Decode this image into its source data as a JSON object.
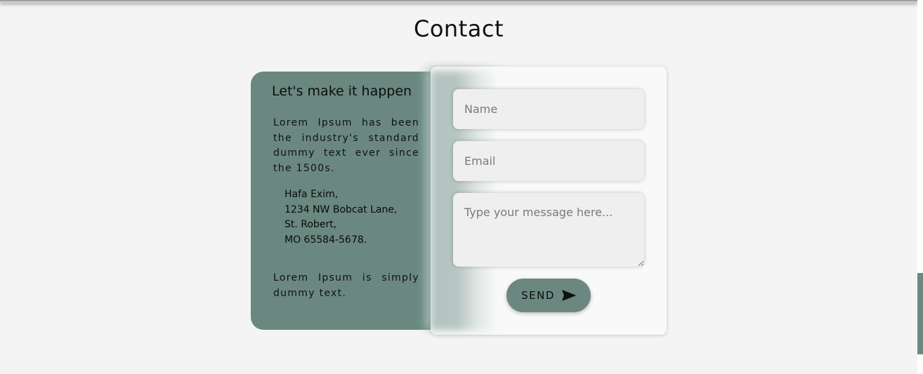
{
  "page": {
    "title": "Contact"
  },
  "info": {
    "heading": "Let's make it happen",
    "intro": "Lorem Ipsum has been the industry's standard dummy text ever since the 1500s.",
    "address": [
      "Hafa Exim,",
      "1234 NW Bobcat Lane,",
      "St. Robert,",
      "MO 65584-5678."
    ],
    "outro": "Lorem Ipsum is simply dummy text."
  },
  "form": {
    "name_placeholder": "Name",
    "email_placeholder": "Email",
    "message_placeholder": "Type your message here...",
    "send_label": "SEND",
    "send_icon": "send-icon"
  },
  "colors": {
    "accent": "#6a8880",
    "background": "#f4f4f4",
    "card": "#f9f9f9"
  }
}
